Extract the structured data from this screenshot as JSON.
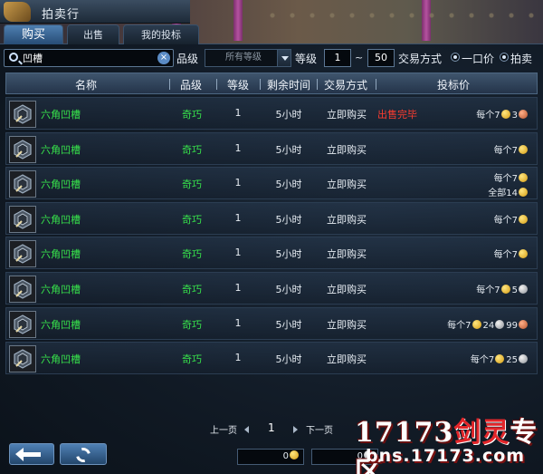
{
  "window": {
    "title": "拍卖行"
  },
  "tabs": [
    {
      "label": "购买"
    },
    {
      "label": "出售"
    },
    {
      "label": "我的投标"
    }
  ],
  "filter": {
    "search_value": "凹槽",
    "grade_label": "品级",
    "grade_select": "所有等级",
    "level_label": "等级",
    "level_min": "1",
    "level_sep": "~",
    "level_max": "50",
    "trade_label": "交易方式",
    "option_fixed": "一口价",
    "option_auction": "拍卖"
  },
  "table": {
    "headers": {
      "name": "名称",
      "grade": "品级",
      "level": "等级",
      "time": "剩余时间",
      "trade": "交易方式",
      "price": "投标价"
    },
    "rows": [
      {
        "name": "六角凹槽",
        "grade": "奇巧",
        "level": "1",
        "time": "5小时",
        "trade": "立即购买",
        "status": "出售完毕",
        "price_line1": [
          {
            "text": "每个7",
            "coin": "gold"
          },
          {
            "text": "3",
            "coin": "copper"
          }
        ],
        "price_line2": []
      },
      {
        "name": "六角凹槽",
        "grade": "奇巧",
        "level": "1",
        "time": "5小时",
        "trade": "立即购买",
        "status": "",
        "price_line1": [
          {
            "text": "每个7",
            "coin": "gold"
          }
        ],
        "price_line2": []
      },
      {
        "name": "六角凹槽",
        "grade": "奇巧",
        "level": "1",
        "time": "5小时",
        "trade": "立即购买",
        "status": "",
        "price_line1": [
          {
            "text": "每个7",
            "coin": "gold"
          }
        ],
        "price_line2": [
          {
            "text": "全部14",
            "coin": "gold"
          }
        ]
      },
      {
        "name": "六角凹槽",
        "grade": "奇巧",
        "level": "1",
        "time": "5小时",
        "trade": "立即购买",
        "status": "",
        "price_line1": [
          {
            "text": "每个7",
            "coin": "gold"
          }
        ],
        "price_line2": []
      },
      {
        "name": "六角凹槽",
        "grade": "奇巧",
        "level": "1",
        "time": "5小时",
        "trade": "立即购买",
        "status": "",
        "price_line1": [
          {
            "text": "每个7",
            "coin": "gold"
          }
        ],
        "price_line2": []
      },
      {
        "name": "六角凹槽",
        "grade": "奇巧",
        "level": "1",
        "time": "5小时",
        "trade": "立即购买",
        "status": "",
        "price_line1": [
          {
            "text": "每个7",
            "coin": "gold"
          },
          {
            "text": "5",
            "coin": "silver"
          }
        ],
        "price_line2": []
      },
      {
        "name": "六角凹槽",
        "grade": "奇巧",
        "level": "1",
        "time": "5小时",
        "trade": "立即购买",
        "status": "",
        "price_line1": [
          {
            "text": "每个7",
            "coin": "gold"
          },
          {
            "text": "24",
            "coin": "silver"
          },
          {
            "text": "99",
            "coin": "copper"
          }
        ],
        "price_line2": []
      },
      {
        "name": "六角凹槽",
        "grade": "奇巧",
        "level": "1",
        "time": "5小时",
        "trade": "立即购买",
        "status": "",
        "price_line1": [
          {
            "text": "每个7",
            "coin": "gold"
          },
          {
            "text": "25",
            "coin": "silver"
          }
        ],
        "price_line2": []
      }
    ]
  },
  "pager": {
    "prev": "上一页",
    "page": "1",
    "next": "下一页"
  },
  "wallet": {
    "gold": "0",
    "silver": "0"
  },
  "watermark": {
    "line1_a": "17173",
    "line1_b": "剑灵",
    "line1_c": "专区",
    "line2": "bns.17173.com"
  },
  "colors": {
    "item_name": "#37e14b",
    "sold_out": "#ff3c2f",
    "tab_active": "#4e7fb1"
  },
  "icons": {
    "item": "hexagon-slot-icon",
    "back": "arrow-left-icon",
    "refresh": "refresh-icon",
    "search": "search-icon",
    "clear": "close-icon"
  }
}
